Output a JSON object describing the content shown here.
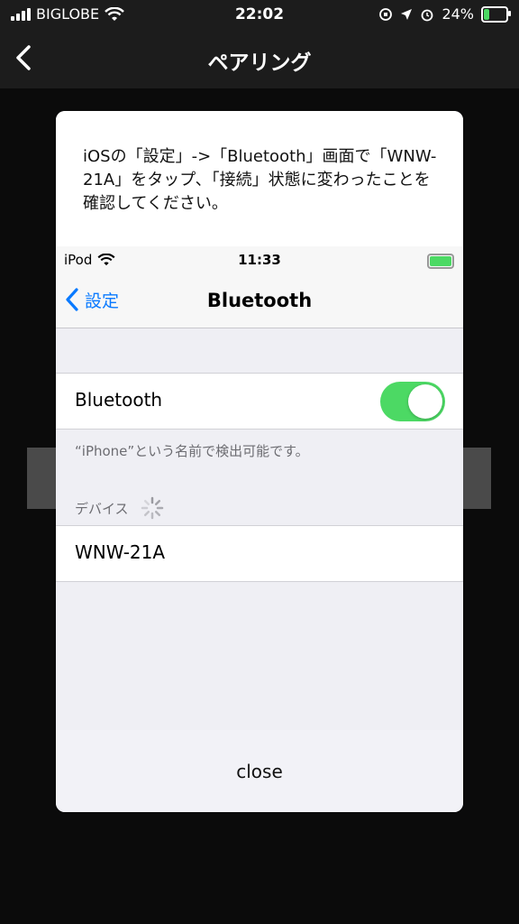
{
  "status_bar": {
    "carrier": "BIGLOBE",
    "time": "22:02",
    "battery": "24%"
  },
  "app_bar": {
    "title": "ペアリング"
  },
  "modal": {
    "instruction": "iOSの「設定」->「Bluetooth」画面で「WNW-21A」をタップ、「接続」状態に変わったことを確認してください。",
    "inner": {
      "status": {
        "device": "iPod",
        "time": "11:33"
      },
      "nav": {
        "back_label": "設定",
        "title": "Bluetooth"
      },
      "bluetooth_row": {
        "label": "Bluetooth",
        "enabled": true
      },
      "discoverable_note": "“iPhone”という名前で検出可能です。",
      "devices_header": "デバイス",
      "devices": [
        {
          "name": "WNW-21A"
        }
      ]
    },
    "close_label": "close"
  },
  "colors": {
    "ios_blue": "#0a7aff",
    "toggle_green": "#4cd964",
    "dark_bg": "#0b0b0b"
  }
}
